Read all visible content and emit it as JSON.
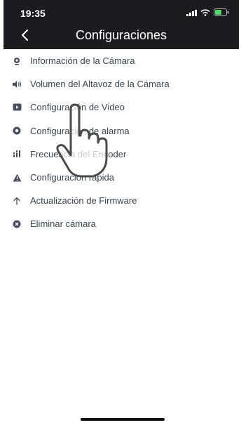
{
  "status_bar": {
    "time": "19:35"
  },
  "header": {
    "title": "Configuraciones",
    "back_icon": "chevron-left-icon"
  },
  "menu": {
    "items": [
      {
        "label": "Información de la Cámara",
        "icon": "camera-icon"
      },
      {
        "label": "Volumen del Altavoz de la Cámara",
        "icon": "speaker-icon"
      },
      {
        "label": "Configuración de Video",
        "icon": "video-icon"
      },
      {
        "label": "Configuración de alarma",
        "icon": "alarm-icon"
      },
      {
        "label": "Frecuencia del Encoder",
        "icon": "bars-icon"
      },
      {
        "label": "Configuración rápida",
        "icon": "warning-icon"
      },
      {
        "label": "Actualización de Firmware",
        "icon": "arrow-up-icon"
      },
      {
        "label": "Eliminar cámara",
        "icon": "delete-icon"
      }
    ]
  },
  "colors": {
    "header_bg": "#1c1c1e",
    "icon": "#4a4f60",
    "text": "#3d4250"
  }
}
